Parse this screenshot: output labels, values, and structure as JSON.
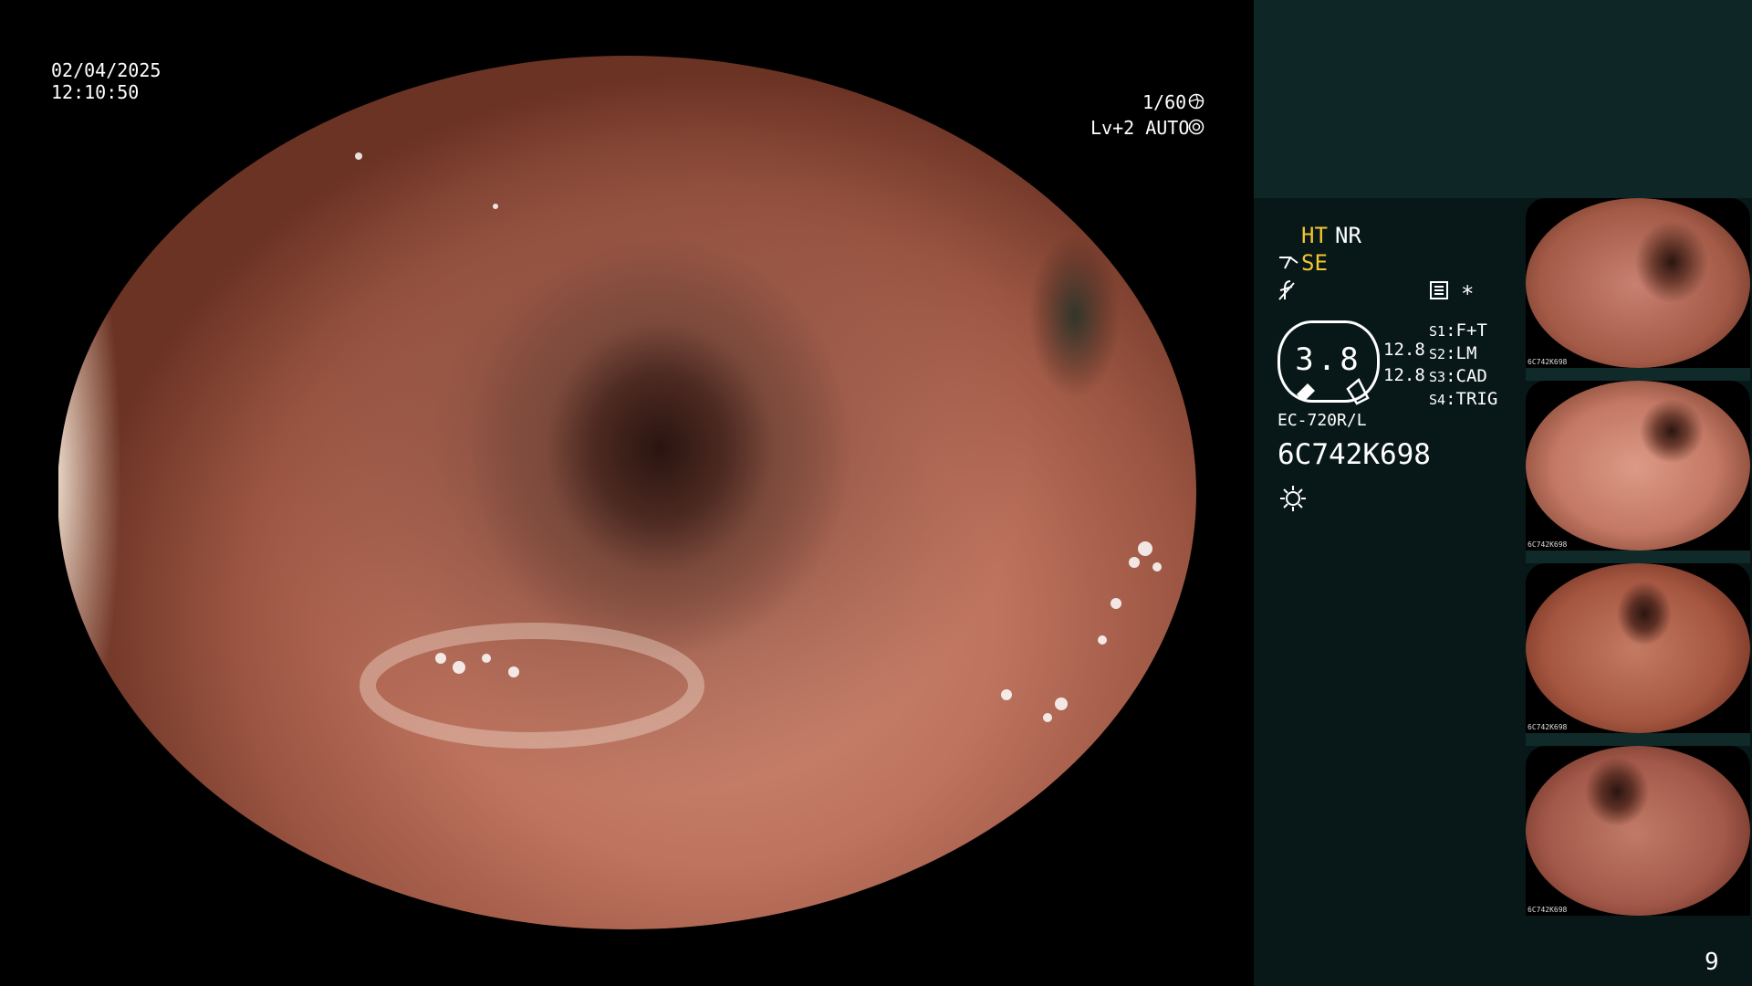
{
  "overlay": {
    "date": "02/04/2025",
    "time": "12:10:50",
    "shutter": "1/60",
    "level": "Lv+2 AUTO"
  },
  "panel": {
    "ht": "HT",
    "nr": "NR",
    "se": "SE",
    "zoom_value": "3.8",
    "values": [
      "12.8",
      "12.8"
    ],
    "presets": [
      {
        "key": "S1",
        "value": "F+T"
      },
      {
        "key": "S2",
        "value": "LM"
      },
      {
        "key": "S3",
        "value": "CAD"
      },
      {
        "key": "S4",
        "value": "TRIG"
      }
    ],
    "scope_model": "EC-720R/L",
    "serial": "6C742K698",
    "asterisk": "*",
    "page_number": "9"
  },
  "icons": [
    "shutter-icon",
    "auto-icon",
    "se-icon",
    "f-icon",
    "memory-icon",
    "light-icon"
  ],
  "thumbnails": [
    {
      "caption": "6C742K698",
      "tone": "#b06a55"
    },
    {
      "caption": "6C742K698",
      "tone": "#c27864"
    },
    {
      "caption": "6C742K698",
      "tone": "#b0624c"
    },
    {
      "caption": "6C742K698",
      "tone": "#a9624c"
    }
  ],
  "colors": {
    "panel_bg": "#081818",
    "panel_top": "#0f2626",
    "accent": "#f2c531"
  }
}
